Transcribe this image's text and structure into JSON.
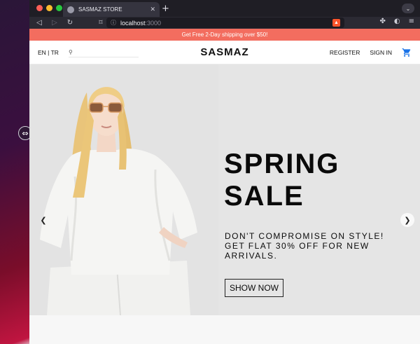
{
  "browser": {
    "tab_title": "SASMAZ STORE",
    "url_host": "localhost",
    "url_port": ":3000",
    "lights": [
      "#fe5f57",
      "#febc2e",
      "#28c840"
    ]
  },
  "store": {
    "promo": "Get Free 2-Day shipping over $50!",
    "language": "EN | TR",
    "search_placeholder": "",
    "logo": "SASMAZ",
    "nav": {
      "register": "REGISTER",
      "signin": "SIGN IN"
    },
    "accent_color": "#f36d5f",
    "cart_color": "#1a73e8"
  },
  "hero": {
    "title": "SPRING\nSALE",
    "subtitle": "DON'T COMPROMISE ON STYLE!\nGET FLAT 30% OFF FOR NEW\nARRIVALS.",
    "cta": "SHOW NOW"
  },
  "icons": {
    "prev": "chevron-left-icon",
    "next": "chevron-right-icon",
    "cart": "cart-icon",
    "search": "search-icon"
  }
}
